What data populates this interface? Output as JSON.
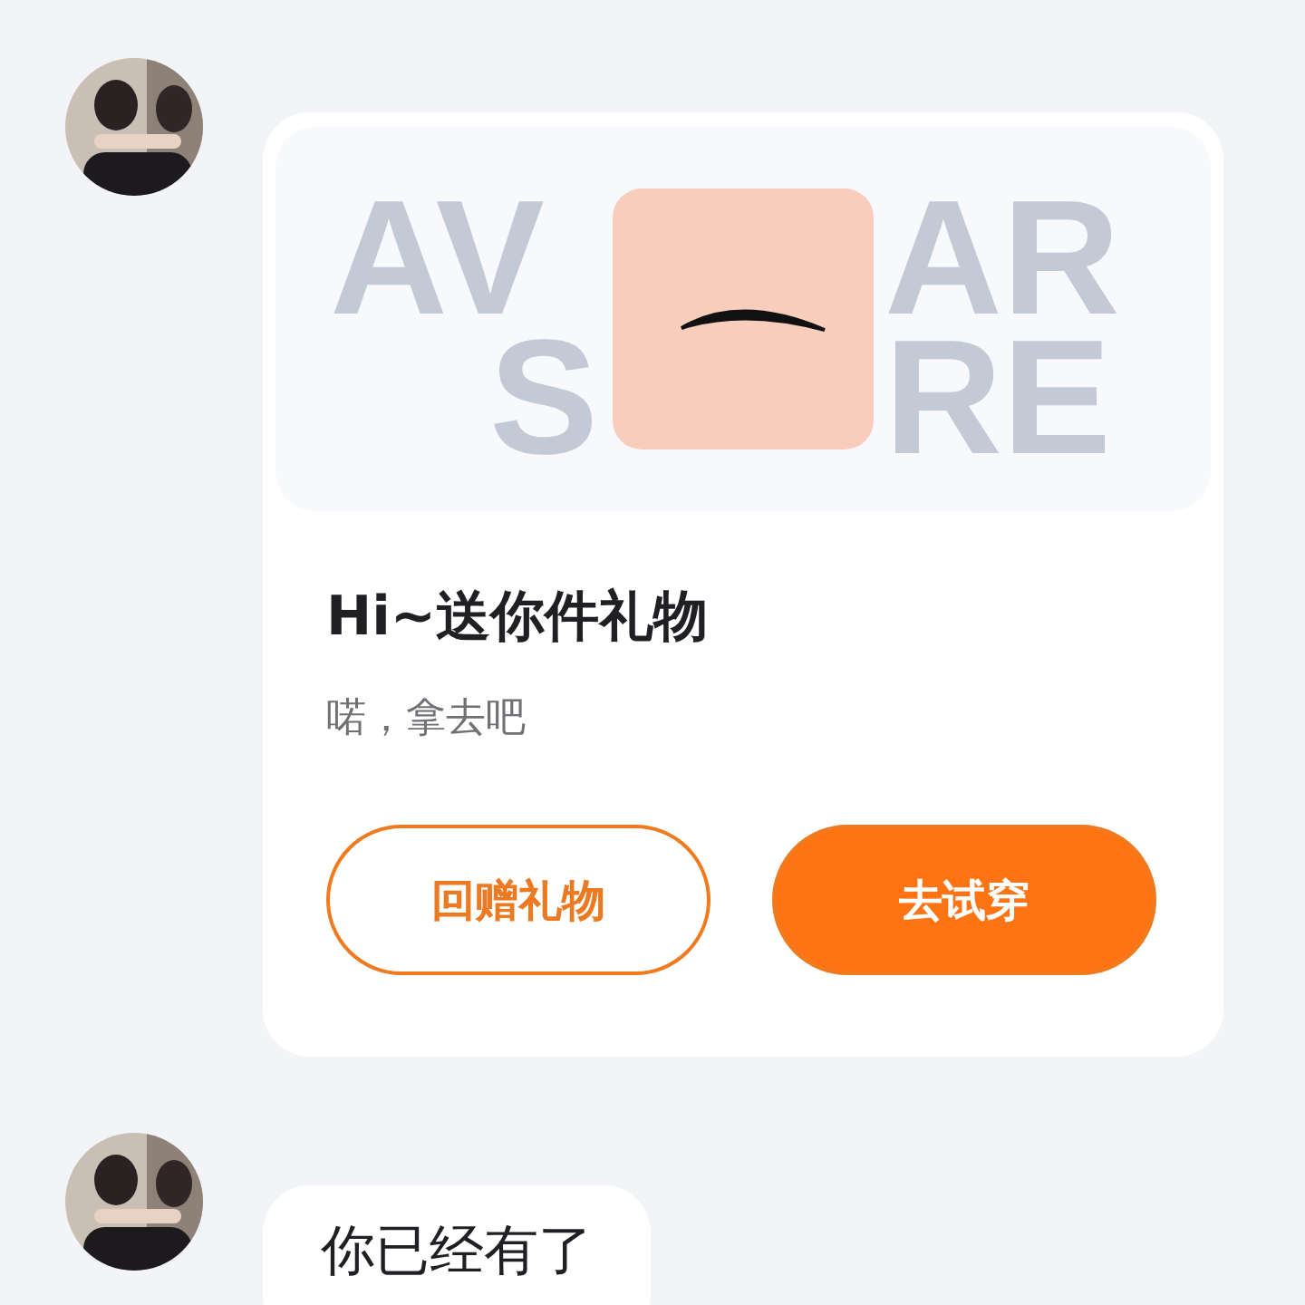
{
  "messages": [
    {
      "kind": "gift_card",
      "banner": {
        "backdrop_fragments": [
          "AV",
          "AR",
          "S",
          "RE"
        ]
      },
      "title": "Hi~送你件礼物",
      "subtitle": "喏，拿去吧",
      "buttons": [
        {
          "label": "回赠礼物",
          "kind": "outline"
        },
        {
          "label": "去试穿",
          "kind": "filled"
        }
      ]
    },
    {
      "kind": "text",
      "text": "你已经有了"
    }
  ]
}
